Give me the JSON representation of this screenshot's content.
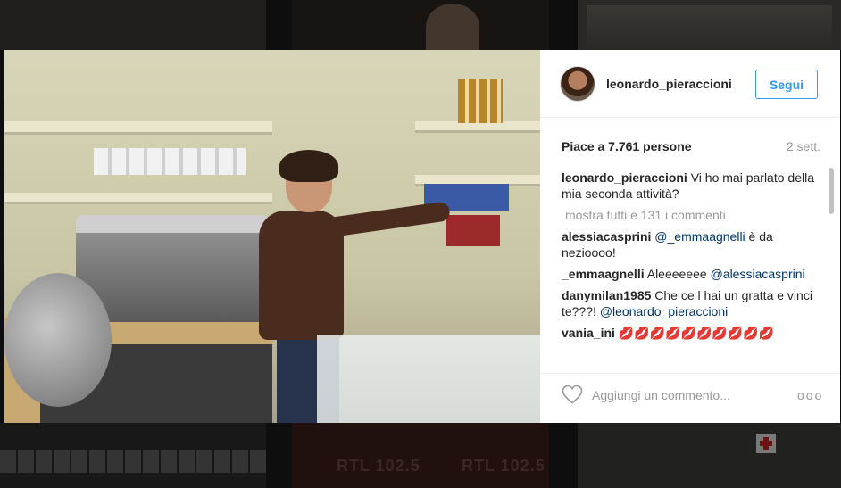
{
  "post": {
    "username": "leonardo_pieraccioni",
    "follow_label": "Segui",
    "likes": "Piace a 7.761 persone",
    "time": "2 sett.",
    "caption_user": "leonardo_pieraccioni",
    "caption_text": " Vi ho mai parlato della mia seconda attività?",
    "view_all": "mostra tutti e 131 i commenti",
    "comments": [
      {
        "user": "alessiacasprini",
        "mention": "@_emmaagnelli",
        "text": " è da nezioooo!"
      },
      {
        "user": "_emmaagnelli",
        "text": " Aleeeeeee ",
        "mention": "@alessiacasprini"
      },
      {
        "user": "danymilan1985",
        "text": " Che ce l hai un gratta e vinci te???! ",
        "mention": "@leonardo_pieraccioni"
      },
      {
        "user": "vania_ini",
        "text": " 💋💋💋💋💋💋💋💋💋💋"
      }
    ],
    "comment_placeholder": "Aggiungi un commento...",
    "more_options": "ooo"
  },
  "background": {
    "thumb_text_1": "RTL 102.5",
    "thumb_text_2": "RTL 102.5"
  },
  "colors": {
    "accent": "#3897f0",
    "text": "#262626",
    "muted": "#999999"
  }
}
